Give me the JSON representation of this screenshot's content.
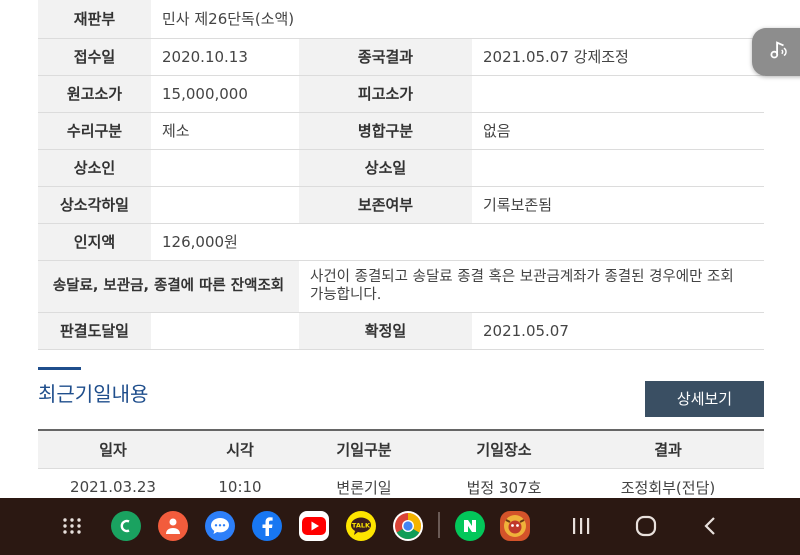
{
  "case_info": {
    "court_division_label": "재판부",
    "court_division_value": "민사 제26단독(소액)",
    "received_label": "접수일",
    "received_value": "2020.10.13",
    "final_result_label": "종국결과",
    "final_result_value": "2021.05.07 강제조정",
    "plaintiff_amount_label": "원고소가",
    "plaintiff_amount_value": "15,000,000",
    "defendant_amount_label": "피고소가",
    "defendant_amount_value": "",
    "acceptance_type_label": "수리구분",
    "acceptance_type_value": "제소",
    "merge_type_label": "병합구분",
    "merge_type_value": "없음",
    "appellant_label": "상소인",
    "appellant_value": "",
    "appeal_date_label": "상소일",
    "appeal_date_value": "",
    "appeal_dismissed_label": "상소각하일",
    "appeal_dismissed_value": "",
    "preservation_label": "보존여부",
    "preservation_value": "기록보존됨",
    "stamp_fee_label": "인지액",
    "stamp_fee_value": "126,000원",
    "balance_label": "송달료, 보관금, 종결에 따른 잔액조회",
    "balance_value": "사건이 종결되고 송달료 종결 혹은 보관금계좌가 종결된 경우에만 조회 가능합니다.",
    "judgment_delivered_label": "판결도달일",
    "judgment_delivered_value": "",
    "confirmed_label": "확정일",
    "confirmed_value": "2021.05.07"
  },
  "hearings": {
    "title": "최근기일내용",
    "detail_button": "상세보기",
    "columns": [
      "일자",
      "시각",
      "기일구분",
      "기일장소",
      "결과"
    ],
    "rows": [
      [
        "2021.03.23",
        "10:10",
        "변론기일",
        "법정 307호",
        "조정회부(전담)"
      ]
    ]
  },
  "floating_button": {
    "icon": "music-note-icon"
  },
  "navbar": {
    "apps": [
      {
        "name": "phone",
        "color": "#1aa260",
        "glyph": "C"
      },
      {
        "name": "contacts",
        "color": "#f25c3c",
        "glyph": "●"
      },
      {
        "name": "messages",
        "color": "#2d7ff9",
        "glyph": "…"
      },
      {
        "name": "facebook",
        "color": "#1877f2",
        "glyph": "f"
      },
      {
        "name": "youtube",
        "color": "#ff0000",
        "glyph": "▶"
      },
      {
        "name": "kakaotalk",
        "color": "#fee500",
        "glyph": "TALK"
      },
      {
        "name": "chrome",
        "color": "#4285f4",
        "glyph": "◉"
      },
      {
        "name": "naver",
        "color": "#03c75a",
        "glyph": "N"
      },
      {
        "name": "game",
        "color": "#d4532a",
        "glyph": "◆"
      }
    ]
  }
}
